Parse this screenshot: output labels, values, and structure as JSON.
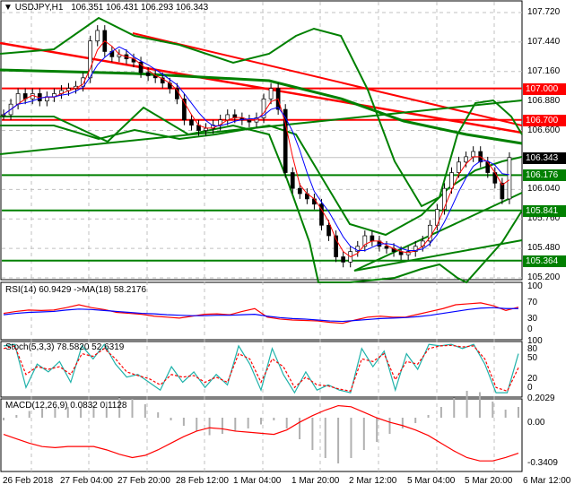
{
  "header": {
    "symbol": "USDJPY,H1",
    "ohlc": "106.351 106.431 106.293 106.343"
  },
  "price_axis": [
    "107.720",
    "107.440",
    "107.160",
    "106.880",
    "106.600",
    "106.040",
    "105.760",
    "105.480",
    "105.200"
  ],
  "levels": [
    {
      "label": "107.000",
      "value": 107.0,
      "color": "#ff0000"
    },
    {
      "label": "106.700",
      "value": 106.7,
      "color": "#ff0000"
    },
    {
      "label": "106.343",
      "value": 106.343,
      "color": "#000000"
    },
    {
      "label": "106.176",
      "value": 106.176,
      "color": "#008000"
    },
    {
      "label": "105.841",
      "value": 105.841,
      "color": "#008000"
    },
    {
      "label": "105.364",
      "value": 105.364,
      "color": "#008000"
    }
  ],
  "rsi": {
    "label": "RSI(14) 60.9429  ->MA(18) 58.2176",
    "axis": [
      "100",
      "70",
      "30",
      "0"
    ]
  },
  "stoch": {
    "label": "Stoch(5,3,3) 78.5820 52.6319",
    "axis": [
      "100",
      "80",
      "50",
      "20",
      "0"
    ]
  },
  "macd": {
    "label": "MACD(12,26,9) 0.0832 0.1128",
    "axis": [
      "0.2029",
      "0.00",
      "-0.3409"
    ]
  },
  "time_axis": [
    "26 Feb 2018",
    "27 Feb 04:00",
    "27 Feb 20:00",
    "28 Feb 12:00",
    "1 Mar 04:00",
    "1 Mar 20:00",
    "2 Mar 12:00",
    "5 Mar 04:00",
    "5 Mar 20:00",
    "6 Mar 12:00"
  ],
  "chart_data": {
    "type": "candlestick",
    "closes": [
      106.75,
      106.85,
      106.95,
      106.9,
      106.95,
      106.88,
      106.92,
      106.95,
      106.98,
      107.0,
      107.02,
      107.1,
      107.45,
      107.55,
      107.35,
      107.3,
      107.32,
      107.28,
      107.25,
      107.15,
      107.12,
      107.1,
      107.05,
      107.0,
      106.9,
      106.7,
      106.65,
      106.6,
      106.62,
      106.65,
      106.7,
      106.75,
      106.72,
      106.7,
      106.68,
      106.72,
      106.9,
      107.0,
      106.8,
      106.2,
      106.05,
      106.0,
      105.95,
      105.9,
      105.7,
      105.6,
      105.4,
      105.35,
      105.45,
      105.5,
      105.6,
      105.55,
      105.5,
      105.48,
      105.45,
      105.42,
      105.45,
      105.5,
      105.55,
      105.7,
      105.85,
      106.05,
      106.2,
      106.3,
      106.35,
      106.4,
      106.3,
      106.2,
      106.1,
      105.95,
      106.343
    ],
    "rsi": [
      48,
      52,
      55,
      54,
      55,
      60,
      66,
      60,
      56,
      50,
      48,
      46,
      42,
      40,
      38,
      42,
      46,
      47,
      45,
      52,
      58,
      40,
      36,
      34,
      33,
      32,
      29,
      27,
      34,
      40,
      42,
      40,
      40,
      46,
      52,
      58,
      66,
      68,
      70,
      64,
      54,
      61
    ],
    "rsi_ma": [
      45,
      48,
      50,
      51,
      52,
      55,
      57,
      56,
      54,
      52,
      50,
      48,
      47,
      45,
      44,
      43,
      43,
      44,
      44,
      45,
      46,
      42,
      39,
      37,
      36,
      34,
      32,
      31,
      33,
      35,
      37,
      38,
      39,
      41,
      44,
      48,
      52,
      56,
      59,
      60,
      58,
      58
    ],
    "stoch_k": [
      95,
      98,
      15,
      60,
      45,
      65,
      25,
      95,
      70,
      98,
      60,
      35,
      40,
      25,
      10,
      55,
      25,
      45,
      15,
      40,
      20,
      95,
      60,
      10,
      90,
      40,
      5,
      45,
      10,
      20,
      10,
      5,
      90,
      55,
      85,
      10,
      80,
      50,
      98,
      95,
      98,
      90,
      98,
      60,
      5,
      5,
      80
    ],
    "stoch_d": [
      90,
      95,
      40,
      55,
      50,
      55,
      40,
      80,
      75,
      90,
      70,
      45,
      38,
      32,
      20,
      40,
      35,
      38,
      25,
      35,
      25,
      80,
      70,
      25,
      70,
      55,
      15,
      35,
      20,
      18,
      12,
      8,
      70,
      65,
      80,
      30,
      65,
      60,
      90,
      95,
      96,
      93,
      95,
      70,
      15,
      8,
      53
    ],
    "macd_hist": [
      -0.02,
      0.02,
      0.05,
      0.07,
      0.08,
      0.08,
      0.08,
      0.09,
      0.12,
      0.15,
      0.14,
      0.1,
      0.04,
      -0.02,
      -0.06,
      -0.1,
      -0.13,
      -0.12,
      -0.1,
      -0.08,
      -0.05,
      -0.02,
      -0.08,
      -0.16,
      -0.24,
      -0.3,
      -0.34,
      -0.3,
      -0.24,
      -0.18,
      -0.12,
      -0.08,
      -0.04,
      0.02,
      0.08,
      0.15,
      0.2,
      0.19,
      0.12,
      0.06,
      0.08
    ],
    "macd_signal": [
      -0.06,
      -0.02,
      0.02,
      0.05,
      0.06,
      0.05,
      0.05,
      0.05,
      0.08,
      0.12,
      0.15,
      0.13,
      0.08,
      0.02,
      -0.04,
      -0.09,
      -0.12,
      -0.11,
      -0.09,
      -0.08,
      -0.07,
      -0.06,
      -0.1,
      -0.17,
      -0.23,
      -0.28,
      -0.32,
      -0.31,
      -0.26,
      -0.21,
      -0.17,
      -0.14,
      -0.1,
      -0.05,
      0.02,
      0.09,
      0.15,
      0.18,
      0.18,
      0.15,
      0.11
    ]
  }
}
